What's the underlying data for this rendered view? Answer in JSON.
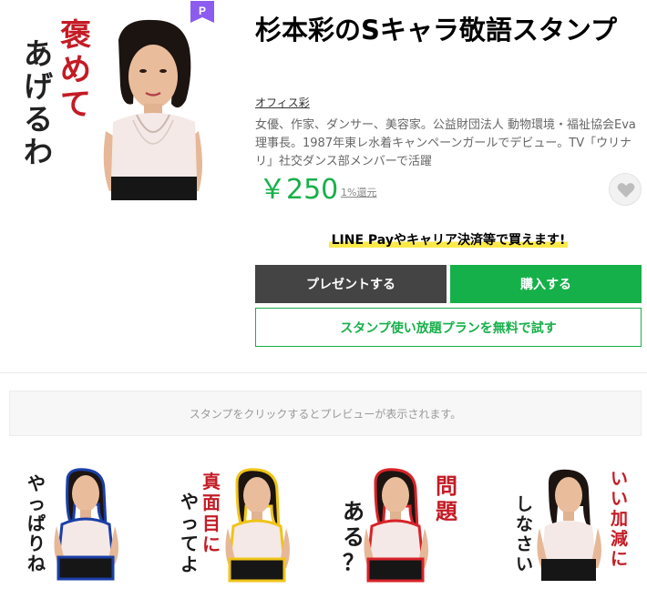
{
  "product": {
    "title": "杉本彩のSキャラ敬語スタンプ",
    "author": "オフィス彩",
    "description": "女優、作家、ダンサー、美容家。公益財団法人 動物環境・福祉協会Eva理事長。1987年東レ水着キャンペーンガールでデビュー。TV「ウリナリ」社交ダンス部メンバーで活躍",
    "price": "￥250",
    "cashback": "1%還元",
    "premium_badge": "P",
    "main_sticker_text": [
      "褒めて",
      "あげるわ"
    ]
  },
  "pay_note": "LINE Payやキャリア決済等で買えます!",
  "buttons": {
    "present": "プレゼントする",
    "buy": "購入する",
    "plan": "スタンプ使い放題プランを無料で試す"
  },
  "favorite": {
    "icon": "heart-icon"
  },
  "preview_hint": "スタンプをクリックするとプレビューが表示されます。",
  "stickers": [
    {
      "text": "やっぱりね",
      "accent": "#1a3fa8"
    },
    {
      "text": "真面目にやってよ",
      "accent": "#f0c419"
    },
    {
      "text": "問題ある？",
      "accent": "#d8232a"
    },
    {
      "text": "いい加減にしなさい",
      "accent": "#d8232a"
    }
  ],
  "colors": {
    "brand_green": "#16b04a",
    "present_button": "#444444",
    "premium_purple": "#8c5cf0",
    "highlight_yellow": "#fbe94a"
  }
}
